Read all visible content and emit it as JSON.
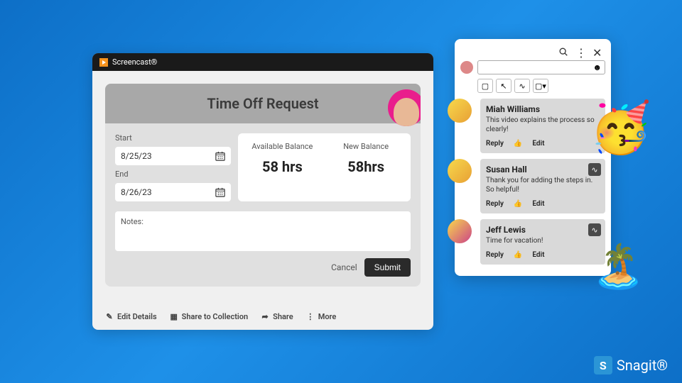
{
  "titlebar": {
    "appname": "Screencast®"
  },
  "form": {
    "title": "Time Off Request",
    "start_label": "Start",
    "start_value": "8/25/23",
    "end_label": "End",
    "end_value": "8/26/23",
    "available_label": "Available Balance",
    "available_value": "58 hrs",
    "new_label": "New Balance",
    "new_value": "58hrs",
    "notes_label": "Notes:",
    "cancel": "Cancel",
    "submit": "Submit"
  },
  "toolbar": {
    "edit_details": "Edit Details",
    "share_collection": "Share to Collection",
    "share": "Share",
    "more": "More"
  },
  "comments": [
    {
      "name": "Miah Williams",
      "text": "This video explains the process so clearly!"
    },
    {
      "name": "Susan Hall",
      "text": "Thank you for adding the steps in. So helpful!"
    },
    {
      "name": "Jeff Lewis",
      "text": "Time for vacation!"
    }
  ],
  "comment_actions": {
    "reply": "Reply",
    "edit": "Edit"
  },
  "snagit": "Snagit®"
}
